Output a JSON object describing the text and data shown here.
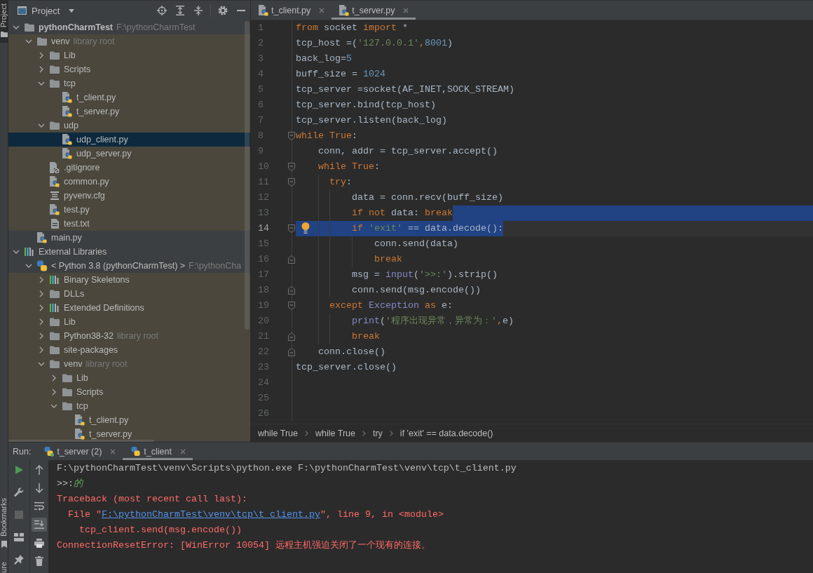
{
  "tool_stripe": [
    {
      "label": "Project",
      "kind": "folder",
      "selected": true
    },
    {
      "label": "Bookmarks",
      "kind": "bookmark",
      "selected": false
    },
    {
      "label": "ure",
      "kind": "plain",
      "selected": false
    }
  ],
  "project_panel": {
    "title": "Project",
    "tree": [
      {
        "name": "pythonCharmTest",
        "note": "F:\\pythonCharmTest",
        "kind": "project",
        "expanded": true,
        "selected": false,
        "library": false,
        "children": [
          {
            "name": "venv",
            "note": "library root",
            "kind": "folder",
            "expanded": true,
            "selected": false,
            "library": true,
            "children": [
              {
                "name": "Lib",
                "kind": "folder",
                "expanded": false,
                "selected": false,
                "library": true
              },
              {
                "name": "Scripts",
                "kind": "folder",
                "expanded": false,
                "selected": false,
                "library": true
              },
              {
                "name": "tcp",
                "kind": "folder",
                "expanded": true,
                "selected": false,
                "library": true,
                "children": [
                  {
                    "name": "t_client.py",
                    "kind": "python",
                    "selected": false,
                    "library": true
                  },
                  {
                    "name": "t_server.py",
                    "kind": "python",
                    "selected": false,
                    "library": true
                  }
                ]
              },
              {
                "name": "udp",
                "kind": "folder",
                "expanded": true,
                "selected": false,
                "library": true,
                "children": [
                  {
                    "name": "udp_client.py",
                    "kind": "python",
                    "selected": true,
                    "library": true
                  },
                  {
                    "name": "udp_server.py",
                    "kind": "python",
                    "selected": false,
                    "library": true
                  }
                ]
              },
              {
                "name": ".gitignore",
                "kind": "ignored",
                "selected": false,
                "library": true
              },
              {
                "name": "common.py",
                "kind": "python",
                "selected": false,
                "library": true
              },
              {
                "name": "pyvenv.cfg",
                "kind": "config",
                "selected": false,
                "library": true
              },
              {
                "name": "test.py",
                "kind": "python",
                "selected": false,
                "library": true
              },
              {
                "name": "test.txt",
                "kind": "text",
                "selected": false,
                "library": true
              }
            ]
          },
          {
            "name": "main.py",
            "kind": "python",
            "selected": false,
            "library": false
          }
        ]
      },
      {
        "name": "External Libraries",
        "kind": "library",
        "expanded": true,
        "selected": false,
        "library": false,
        "children": [
          {
            "name": "< Python 3.8 (pythonCharmTest) >",
            "note": "F:\\pythonCha",
            "kind": "sdk",
            "expanded": true,
            "selected": false,
            "library": false,
            "children": [
              {
                "name": "Binary Skeletons",
                "kind": "library",
                "expanded": false,
                "selected": false,
                "library": true
              },
              {
                "name": "DLLs",
                "kind": "folder",
                "expanded": false,
                "selected": false,
                "library": true
              },
              {
                "name": "Extended Definitions",
                "kind": "library",
                "expanded": false,
                "selected": false,
                "library": true
              },
              {
                "name": "Lib",
                "kind": "folder",
                "expanded": false,
                "selected": false,
                "library": true
              },
              {
                "name": "Python38-32",
                "note": "library root",
                "kind": "folder",
                "expanded": false,
                "selected": false,
                "library": true
              },
              {
                "name": "site-packages",
                "kind": "folder",
                "expanded": false,
                "selected": false,
                "library": true
              },
              {
                "name": "venv",
                "note": "library root",
                "kind": "folder",
                "expanded": true,
                "selected": false,
                "library": true,
                "children": [
                  {
                    "name": "Lib",
                    "kind": "folder",
                    "expanded": false,
                    "selected": false,
                    "library": true
                  },
                  {
                    "name": "Scripts",
                    "kind": "folder",
                    "expanded": false,
                    "selected": false,
                    "library": true
                  },
                  {
                    "name": "tcp",
                    "kind": "folder",
                    "expanded": true,
                    "selected": false,
                    "library": true,
                    "children": [
                      {
                        "name": "t_client.py",
                        "kind": "python",
                        "selected": false,
                        "library": true
                      },
                      {
                        "name": "t_server.py",
                        "kind": "python",
                        "selected": false,
                        "library": true
                      }
                    ]
                  }
                ]
              }
            ]
          }
        ]
      }
    ]
  },
  "editor": {
    "tabs": [
      {
        "label": "t_client.py",
        "selected": false
      },
      {
        "label": "t_server.py",
        "selected": true
      }
    ],
    "lines": [
      {
        "number": "1",
        "selected": false,
        "selected_tail": false,
        "current": false,
        "fold_start": false,
        "fold_end": false,
        "bulb": false,
        "tokens": [
          {
            "text": "from",
            "kind": "keyword"
          },
          {
            "text": " socket ",
            "kind": "plain"
          },
          {
            "text": "import",
            "kind": "keyword"
          },
          {
            "text": " *",
            "kind": "plain"
          }
        ]
      },
      {
        "number": "2",
        "selected": false,
        "selected_tail": false,
        "current": false,
        "fold_start": false,
        "fold_end": false,
        "bulb": false,
        "tokens": [
          {
            "text": "tcp_host =(",
            "kind": "plain"
          },
          {
            "text": "'127.0.0.1'",
            "kind": "string"
          },
          {
            "text": ",",
            "kind": "punct"
          },
          {
            "text": "8001",
            "kind": "number"
          },
          {
            "text": ")",
            "kind": "plain"
          }
        ]
      },
      {
        "number": "3",
        "selected": false,
        "selected_tail": false,
        "current": false,
        "fold_start": false,
        "fold_end": false,
        "bulb": false,
        "tokens": [
          {
            "text": "back_log=",
            "kind": "plain"
          },
          {
            "text": "5",
            "kind": "number"
          }
        ]
      },
      {
        "number": "4",
        "selected": false,
        "selected_tail": false,
        "current": false,
        "fold_start": false,
        "fold_end": false,
        "bulb": false,
        "tokens": [
          {
            "text": "buff_size = ",
            "kind": "plain"
          },
          {
            "text": "1024",
            "kind": "number"
          }
        ]
      },
      {
        "number": "5",
        "selected": false,
        "selected_tail": false,
        "current": false,
        "fold_start": false,
        "fold_end": false,
        "bulb": false,
        "tokens": [
          {
            "text": "tcp_server =socket(AF_INET,SOCK_STREAM)",
            "kind": "plain"
          }
        ]
      },
      {
        "number": "6",
        "selected": false,
        "selected_tail": false,
        "current": false,
        "fold_start": false,
        "fold_end": false,
        "bulb": false,
        "tokens": [
          {
            "text": "tcp_server.bind(tcp_host)",
            "kind": "plain"
          }
        ]
      },
      {
        "number": "7",
        "selected": false,
        "selected_tail": false,
        "current": false,
        "fold_start": false,
        "fold_end": false,
        "bulb": false,
        "tokens": [
          {
            "text": "tcp_server.listen(back_log)",
            "kind": "plain"
          }
        ]
      },
      {
        "number": "8",
        "selected": false,
        "selected_tail": false,
        "current": false,
        "fold_start": true,
        "fold_end": false,
        "bulb": false,
        "tokens": [
          {
            "text": "while",
            "kind": "keyword"
          },
          {
            "text": " True",
            "kind": "keyword"
          },
          {
            "text": ":",
            "kind": "plain"
          }
        ]
      },
      {
        "number": "9",
        "selected": false,
        "selected_tail": false,
        "current": false,
        "fold_start": false,
        "fold_end": false,
        "bulb": false,
        "tokens": [
          {
            "text": "    conn, addr = tcp_server.accept()",
            "kind": "plain"
          }
        ]
      },
      {
        "number": "10",
        "selected": false,
        "selected_tail": false,
        "current": false,
        "fold_start": true,
        "fold_end": false,
        "bulb": false,
        "tokens": [
          {
            "text": "    while",
            "kind": "keyword"
          },
          {
            "text": " True",
            "kind": "keyword"
          },
          {
            "text": ":",
            "kind": "plain"
          }
        ]
      },
      {
        "number": "11",
        "selected": false,
        "selected_tail": false,
        "current": false,
        "fold_start": true,
        "fold_end": false,
        "bulb": false,
        "tokens": [
          {
            "text": "      try",
            "kind": "keyword"
          },
          {
            "text": ":",
            "kind": "plain"
          }
        ]
      },
      {
        "number": "12",
        "selected": false,
        "selected_tail": false,
        "current": false,
        "fold_start": false,
        "fold_end": false,
        "bulb": false,
        "tokens": [
          {
            "text": "          data = conn.recv(buff_size)",
            "kind": "plain"
          }
        ]
      },
      {
        "number": "13",
        "selected": false,
        "selected_tail": true,
        "current": false,
        "fold_start": false,
        "fold_end": false,
        "bulb": false,
        "tokens": [
          {
            "text": "          if",
            "kind": "keyword"
          },
          {
            "text": " not",
            "kind": "keyword"
          },
          {
            "text": " data: ",
            "kind": "plain"
          },
          {
            "text": "break",
            "kind": "keyword"
          }
        ]
      },
      {
        "number": "14",
        "selected": true,
        "selected_tail": false,
        "current": true,
        "fold_start": true,
        "fold_end": false,
        "bulb": true,
        "tokens": [
          {
            "text": "          if",
            "kind": "keyword"
          },
          {
            "text": " 'exit'",
            "kind": "string"
          },
          {
            "text": " == data.decode():",
            "kind": "plain"
          }
        ]
      },
      {
        "number": "15",
        "selected": false,
        "selected_tail": false,
        "current": false,
        "fold_start": false,
        "fold_end": false,
        "bulb": false,
        "tokens": [
          {
            "text": "              conn.send(data)",
            "kind": "plain"
          }
        ]
      },
      {
        "number": "16",
        "selected": false,
        "selected_tail": false,
        "current": false,
        "fold_start": false,
        "fold_end": true,
        "bulb": false,
        "tokens": [
          {
            "text": "              break",
            "kind": "keyword"
          }
        ]
      },
      {
        "number": "17",
        "selected": false,
        "selected_tail": false,
        "current": false,
        "fold_start": false,
        "fold_end": false,
        "bulb": false,
        "tokens": [
          {
            "text": "          msg = ",
            "kind": "plain"
          },
          {
            "text": "input",
            "kind": "builtin"
          },
          {
            "text": "(",
            "kind": "plain"
          },
          {
            "text": "'>>:'",
            "kind": "string"
          },
          {
            "text": ").strip()",
            "kind": "plain"
          }
        ]
      },
      {
        "number": "18",
        "selected": false,
        "selected_tail": false,
        "current": false,
        "fold_start": false,
        "fold_end": true,
        "bulb": false,
        "tokens": [
          {
            "text": "          conn.send(msg.encode())",
            "kind": "plain"
          }
        ]
      },
      {
        "number": "19",
        "selected": false,
        "selected_tail": false,
        "current": false,
        "fold_start": true,
        "fold_end": false,
        "bulb": false,
        "tokens": [
          {
            "text": "      except",
            "kind": "keyword"
          },
          {
            "text": " Exception",
            "kind": "builtin"
          },
          {
            "text": " as",
            "kind": "keyword"
          },
          {
            "text": " e:",
            "kind": "plain"
          }
        ]
      },
      {
        "number": "20",
        "selected": false,
        "selected_tail": false,
        "current": false,
        "fold_start": false,
        "fold_end": false,
        "bulb": false,
        "tokens": [
          {
            "text": "          print",
            "kind": "builtin"
          },
          {
            "text": "(",
            "kind": "plain"
          },
          {
            "text": "'程序出现异常，异常为：'",
            "kind": "string"
          },
          {
            "text": ",",
            "kind": "punct"
          },
          {
            "text": "e)",
            "kind": "plain"
          }
        ]
      },
      {
        "number": "21",
        "selected": false,
        "selected_tail": false,
        "current": false,
        "fold_start": false,
        "fold_end": true,
        "bulb": false,
        "tokens": [
          {
            "text": "          break",
            "kind": "keyword"
          }
        ]
      },
      {
        "number": "22",
        "selected": false,
        "selected_tail": false,
        "current": false,
        "fold_start": false,
        "fold_end": true,
        "bulb": false,
        "tokens": [
          {
            "text": "    conn.close()",
            "kind": "plain"
          }
        ]
      },
      {
        "number": "23",
        "selected": false,
        "selected_tail": false,
        "current": false,
        "fold_start": false,
        "fold_end": false,
        "bulb": false,
        "tokens": [
          {
            "text": "tcp_server.close()",
            "kind": "plain"
          }
        ]
      },
      {
        "number": "24",
        "selected": false,
        "selected_tail": false,
        "current": false,
        "fold_start": false,
        "fold_end": false,
        "bulb": false
      },
      {
        "number": "25",
        "selected": false,
        "selected_tail": false,
        "current": false,
        "fold_start": false,
        "fold_end": false,
        "bulb": false
      },
      {
        "number": "26",
        "selected": false,
        "selected_tail": false,
        "current": false,
        "fold_start": false,
        "fold_end": false,
        "bulb": false
      }
    ],
    "breadcrumbs": [
      "while True",
      "while True",
      "try",
      "if 'exit' == data.decode()"
    ]
  },
  "run_panel": {
    "title": "Run:",
    "tabs": [
      {
        "label": "t_server (2)",
        "selected": false,
        "running": true
      },
      {
        "label": "t_client",
        "selected": true,
        "running": false
      }
    ],
    "run_toolbar": [
      {
        "kind": "run",
        "disabled": false
      },
      {
        "kind": "wrench",
        "disabled": false
      },
      {
        "kind": "stop",
        "disabled": true
      },
      {
        "kind": "layout",
        "disabled": false
      },
      {
        "kind": "pin",
        "disabled": false
      }
    ],
    "console_toolbar": [
      {
        "kind": "up",
        "on": false
      },
      {
        "kind": "down",
        "on": false
      },
      {
        "kind": "wrap",
        "on": false
      },
      {
        "kind": "scroll_end",
        "on": true
      },
      {
        "kind": "print",
        "on": false
      },
      {
        "kind": "trash",
        "on": false
      }
    ],
    "console": [
      [
        {
          "text": "F:\\pythonCharmTest\\venv\\Scripts\\python.exe F:\\pythonCharmTest\\venv\\tcp\\t_client.py",
          "kind": "system"
        }
      ],
      [
        {
          "text": ">>:",
          "kind": "system"
        },
        {
          "text": "的",
          "kind": "input"
        }
      ],
      [
        {
          "text": "Traceback (most recent call last):",
          "kind": "error"
        }
      ],
      [
        {
          "text": "  File \"",
          "kind": "error"
        },
        {
          "text": "F:\\pythonCharmTest\\venv\\tcp\\t_client.py",
          "kind": "link"
        },
        {
          "text": "\", line 9, in <module>",
          "kind": "error"
        }
      ],
      [
        {
          "text": "    tcp_client.send(msg.encode())",
          "kind": "error"
        }
      ],
      [
        {
          "text": "ConnectionResetError: [WinError 10054] 远程主机强迫关闭了一个现有的连接。",
          "kind": "error"
        }
      ]
    ]
  }
}
